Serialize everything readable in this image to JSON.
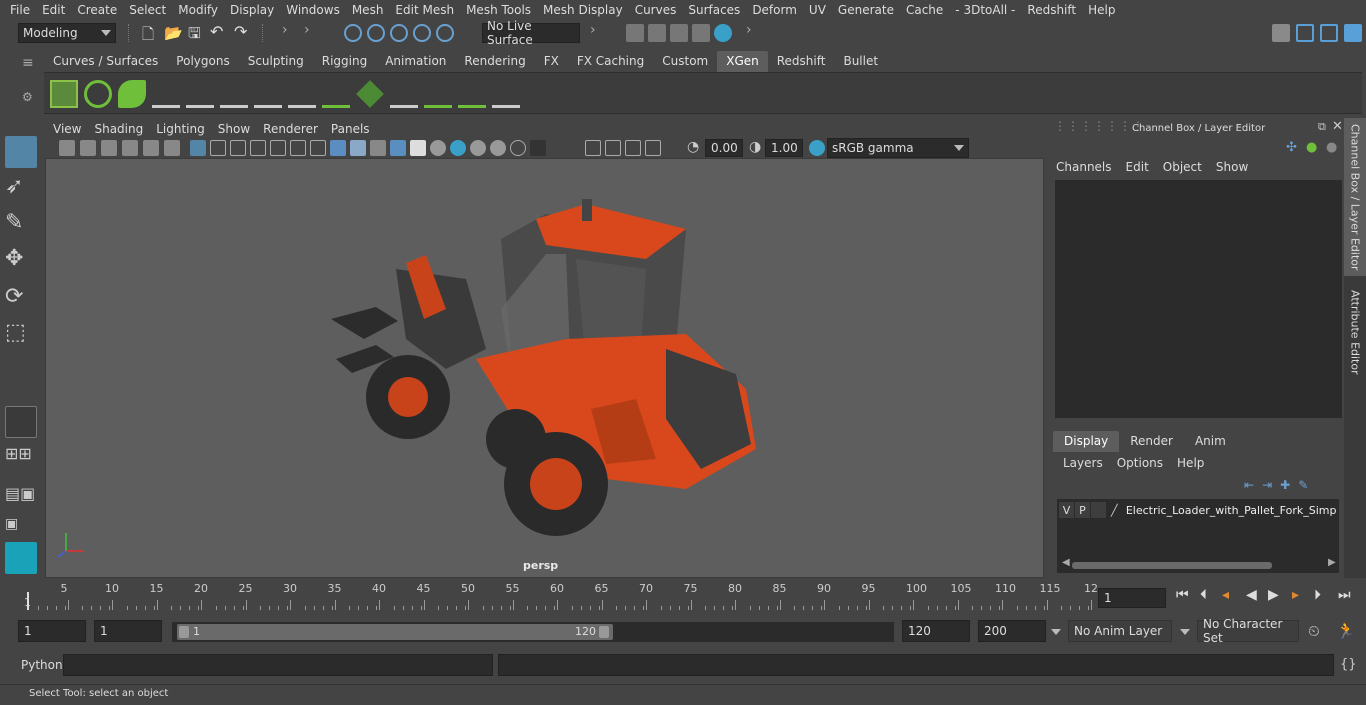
{
  "menubar": [
    "File",
    "Edit",
    "Create",
    "Select",
    "Modify",
    "Display",
    "Windows",
    "Mesh",
    "Edit Mesh",
    "Mesh Tools",
    "Mesh Display",
    "Curves",
    "Surfaces",
    "Deform",
    "UV",
    "Generate",
    "Cache",
    "- 3DtoAll -",
    "Redshift",
    "Help"
  ],
  "status_line": {
    "mode": "Modeling",
    "live_surface": "No Live Surface"
  },
  "shelf_tabs": [
    "Curves / Surfaces",
    "Polygons",
    "Sculpting",
    "Rigging",
    "Animation",
    "Rendering",
    "FX",
    "FX Caching",
    "Custom",
    "XGen",
    "Redshift",
    "Bullet"
  ],
  "shelf_active": "XGen",
  "viewport": {
    "menus": [
      "View",
      "Shading",
      "Lighting",
      "Show",
      "Renderer",
      "Panels"
    ],
    "exposure": "0.00",
    "gamma": "1.00",
    "color_space": "sRGB gamma",
    "camera_label": "persp"
  },
  "channel_box": {
    "title": "Channel Box / Layer Editor",
    "menus": [
      "Channels",
      "Edit",
      "Object",
      "Show"
    ]
  },
  "side_tabs": [
    "Channel Box / Layer Editor",
    "Attribute Editor"
  ],
  "layer_editor": {
    "tabs": [
      "Display",
      "Render",
      "Anim"
    ],
    "active_tab": "Display",
    "menus": [
      "Layers",
      "Options",
      "Help"
    ],
    "layer": {
      "v": "V",
      "p": "P",
      "name": "Electric_Loader_with_Pallet_Fork_Simple_"
    }
  },
  "timeline": {
    "ticks": [
      "5",
      "10",
      "15",
      "20",
      "25",
      "30",
      "35",
      "40",
      "45",
      "50",
      "55",
      "60",
      "65",
      "70",
      "75",
      "80",
      "85",
      "90",
      "95",
      "100",
      "105",
      "110",
      "115",
      "12"
    ],
    "start_marker": "1",
    "current_frame": "1"
  },
  "range": {
    "start_field": "1",
    "start_field2": "1",
    "slider_start": "1",
    "slider_end": "120",
    "end_field": "120",
    "end_field2": "200",
    "anim_layer": "No Anim Layer",
    "char_set": "No Character Set"
  },
  "command_line": {
    "label": "Python"
  },
  "help_line": "Select Tool: select an object",
  "colors": {
    "loader_body": "#d9481c",
    "viewport_bg": "#5e5e5e",
    "active_tab": "#5d5d5d"
  }
}
